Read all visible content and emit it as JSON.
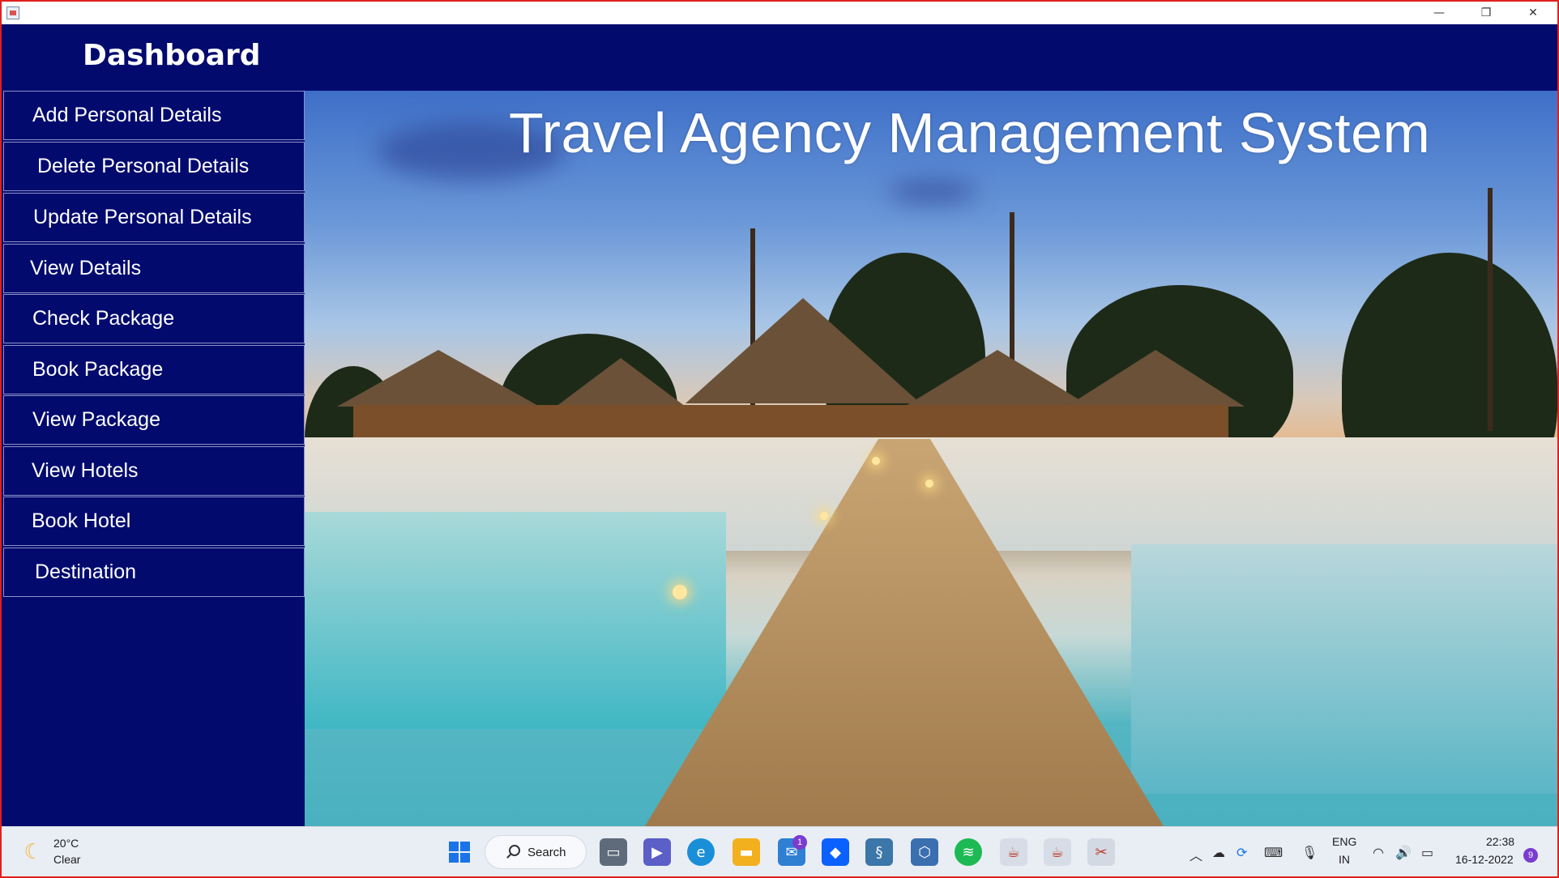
{
  "window": {
    "minimize_glyph": "—",
    "maximize_glyph": "❐",
    "close_glyph": "✕"
  },
  "header": {
    "title": "Dashboard"
  },
  "sidebar": {
    "items": [
      {
        "label": "Add Personal Details"
      },
      {
        "label": "Delete Personal Details"
      },
      {
        "label": "Update Personal Details"
      },
      {
        "label": "View Details"
      },
      {
        "label": "Check Package"
      },
      {
        "label": "Book Package"
      },
      {
        "label": "View Package"
      },
      {
        "label": "View Hotels"
      },
      {
        "label": "Book Hotel"
      },
      {
        "label": "Destination"
      }
    ]
  },
  "hero": {
    "title": "Travel Agency Management System"
  },
  "taskbar": {
    "weather_temp": "20°C",
    "weather_desc": "Clear",
    "search_label": "Search",
    "mail_badge": "1",
    "lang_line1": "ENG",
    "lang_line2": "IN",
    "time": "22:38",
    "date": "16-12-2022",
    "notification_count": "9"
  },
  "colors": {
    "navy": "#020a6e",
    "button_border": "#8b93c8",
    "window_border": "#e0201c"
  },
  "icons": [
    "app-java-icon",
    "weather-moon-icon",
    "windows-start-icon",
    "search-icon",
    "task-view-icon",
    "teams-icon",
    "edge-icon",
    "file-explorer-icon",
    "mail-icon",
    "dropbox-icon",
    "python-icon",
    "virtualbox-icon",
    "spotify-icon",
    "java-icon",
    "java-icon",
    "snipping-tool-icon",
    "chevron-up-icon",
    "cloud-icon",
    "sync-icon",
    "keyboard-icon",
    "microphone-icon",
    "wifi-icon",
    "volume-icon",
    "battery-icon"
  ]
}
